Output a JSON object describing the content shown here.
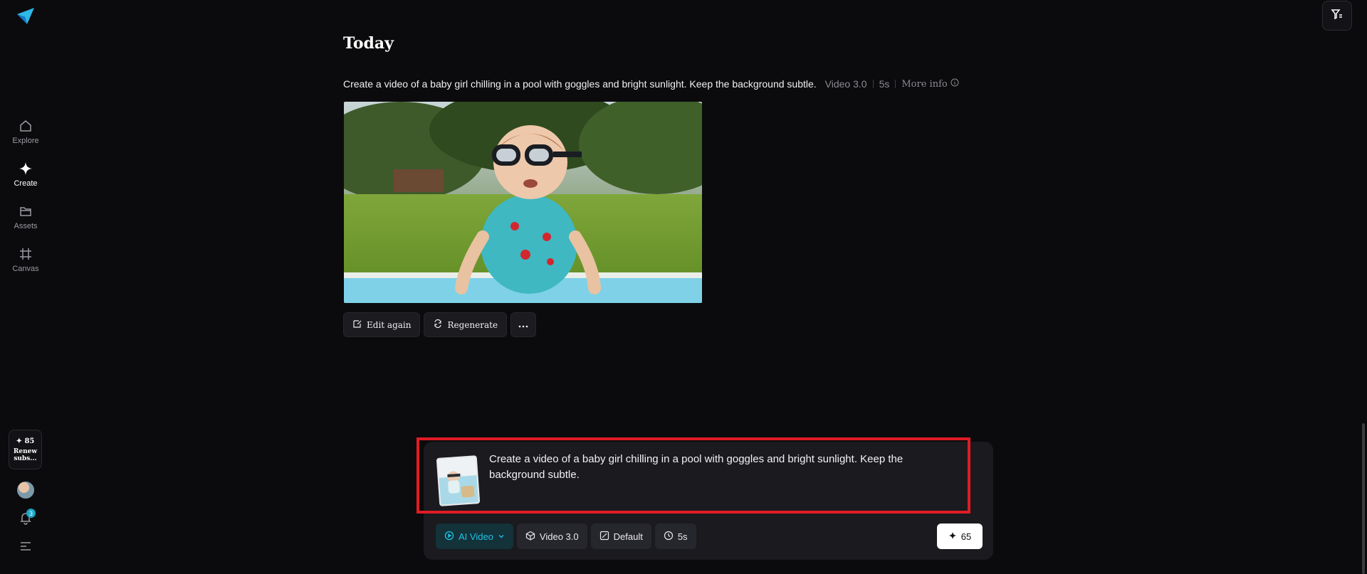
{
  "sidebar": {
    "items": [
      {
        "label": "Explore",
        "icon": "home-icon"
      },
      {
        "label": "Create",
        "icon": "sparkle-icon"
      },
      {
        "label": "Assets",
        "icon": "folder-icon"
      },
      {
        "label": "Canvas",
        "icon": "crop-icon"
      }
    ],
    "credits_value": "✦ 85",
    "credits_label": "Renew subs...",
    "notifications_count": "3"
  },
  "main": {
    "section_title": "Today",
    "prompt_text": "Create a video of a baby girl chilling in a pool with goggles and bright sunlight. Keep the background subtle.",
    "model": "Video 3.0",
    "duration": "5s",
    "more_info": "More info",
    "actions": {
      "edit_again": "Edit again",
      "regenerate": "Regenerate"
    }
  },
  "composer": {
    "text": "Create a video of a baby girl chilling in a pool with goggles and bright sunlight. Keep the background subtle.",
    "mode": "AI Video",
    "model": "Video 3.0",
    "ratio": "Default",
    "duration": "5s",
    "cost": "65"
  },
  "colors": {
    "accent": "#22c3e6",
    "highlight": "#e01b24",
    "background": "#0b0b0d"
  }
}
